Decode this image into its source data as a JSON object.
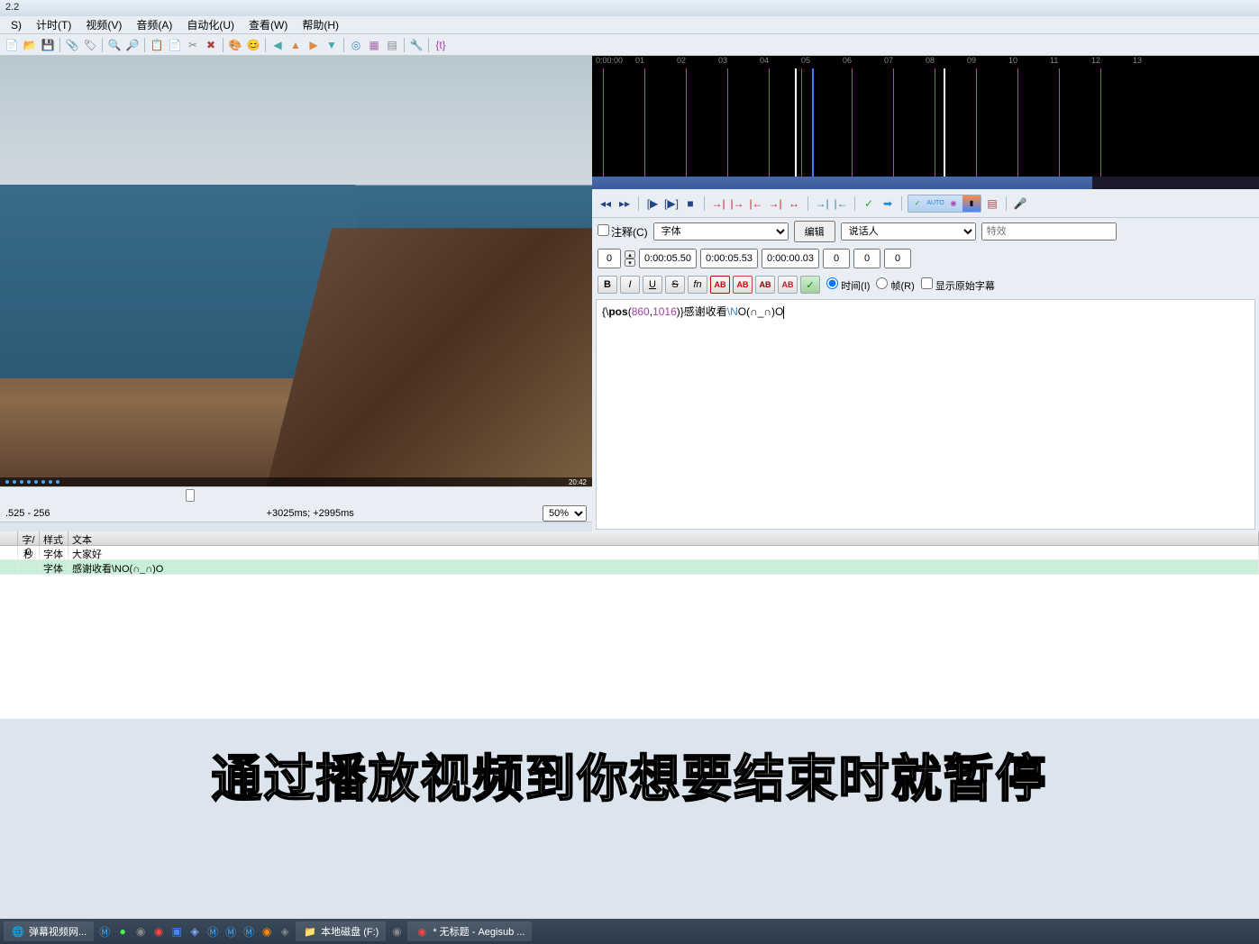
{
  "window": {
    "title": "2.2"
  },
  "menu": {
    "items": [
      "S)",
      "计时(T)",
      "视频(V)",
      "音频(A)",
      "自动化(U)",
      "查看(W)",
      "帮助(H)"
    ]
  },
  "video": {
    "time_display": "20:42",
    "status_left": ".525 - 256",
    "status_center": "+3025ms; +2995ms",
    "zoom": "50%"
  },
  "waveform": {
    "timecodes": [
      "0:00:00",
      "01",
      "02",
      "03",
      "04",
      "05",
      "06",
      "07",
      "08",
      "09",
      "10",
      "11",
      "12",
      "13"
    ]
  },
  "edit": {
    "comment_label": "注释(C)",
    "style": "字体",
    "edit_btn": "编辑",
    "actor_placeholder": "说话人",
    "effect_placeholder": "特效",
    "layer": "0",
    "start_time": "0:00:05.50",
    "end_time": "0:00:05.53",
    "duration": "0:00:00.03",
    "margin_l": "0",
    "margin_r": "0",
    "margin_v": "0",
    "time_radio": "时间(I)",
    "frame_radio": "帧(R)",
    "show_original": "显示原始字幕",
    "text_pos_prefix": "{\\",
    "text_pos_kw": "pos",
    "text_pos_paren_open": "(",
    "text_pos_num1": "860",
    "text_pos_comma": ",",
    "text_pos_num2": "1016",
    "text_pos_close": ")}",
    "text_content": "感谢收看",
    "text_escape": "\\N",
    "text_tail": "O(∩_∩)O"
  },
  "format_buttons": {
    "bold": "B",
    "italic": "I",
    "underline": "U",
    "strike": "S",
    "fn": "fn",
    "ab1": "AB",
    "ab2": "AB",
    "ab3": "AB",
    "ab4": "AB",
    "commit": "✓"
  },
  "grid": {
    "headers": {
      "cps": "字/秒",
      "style": "样式",
      "text": "文本"
    },
    "rows": [
      {
        "sec": "",
        "cps": "0",
        "style": "字体",
        "text": "大家好",
        "selected": false
      },
      {
        "sec": "",
        "cps": "",
        "style": "字体",
        "text": "感谢收看\\NO(∩_∩)O",
        "selected": true
      }
    ]
  },
  "overlay_subtitle": "通过播放视频到你想要结束时就暂停",
  "taskbar": {
    "items": [
      {
        "label": "弹幕视频网..."
      },
      {
        "label": ""
      },
      {
        "label": ""
      },
      {
        "label": ""
      },
      {
        "label": ""
      },
      {
        "label": ""
      },
      {
        "label": ""
      },
      {
        "label": ""
      },
      {
        "label": ""
      },
      {
        "label": ""
      },
      {
        "label": ""
      },
      {
        "label": ""
      },
      {
        "label": ""
      },
      {
        "label": "本地磁盘 (F:)"
      },
      {
        "label": ""
      },
      {
        "label": "* 无标题 - Aegisub ..."
      }
    ]
  }
}
